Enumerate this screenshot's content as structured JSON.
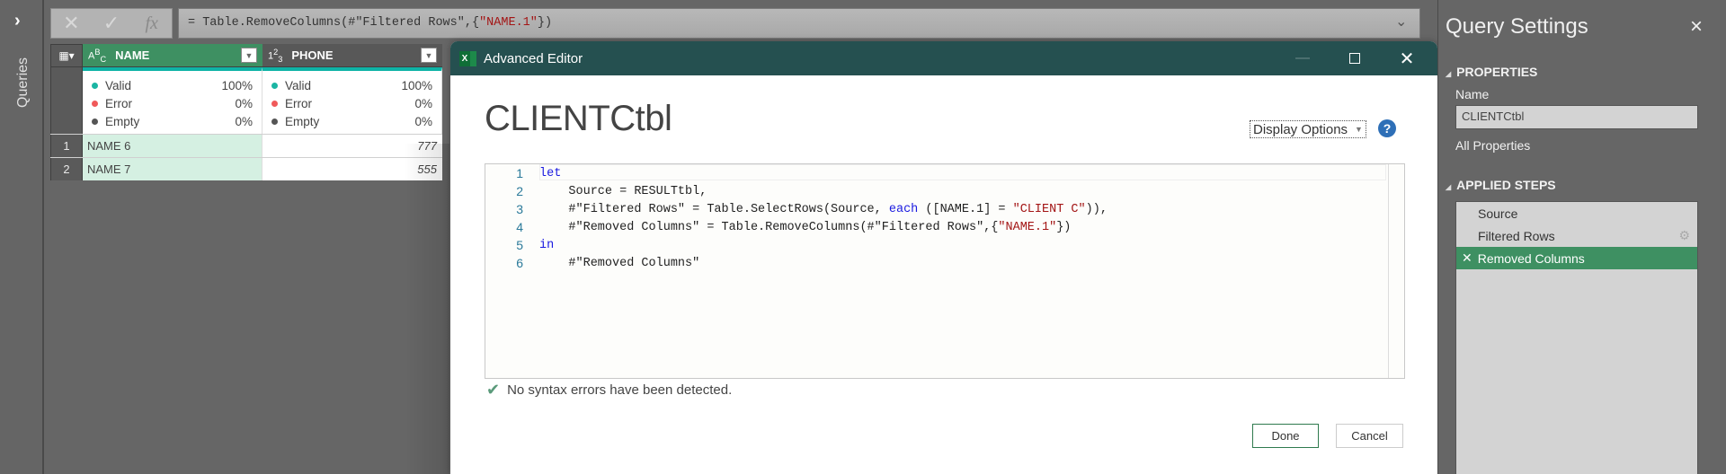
{
  "rail": {
    "label": "Queries",
    "expand_icon": "chevron-right-icon"
  },
  "formula_bar": {
    "prefix": "= Table.RemoveColumns(#\"Filtered Rows\",{",
    "string_part": "\"NAME.1\"",
    "suffix": "})",
    "cancel_glyph": "✕",
    "commit_glyph": "✓",
    "fx_label": "fx"
  },
  "grid": {
    "columns": [
      {
        "name": "NAME",
        "type_glyph": "ABC",
        "selected": true
      },
      {
        "name": "PHONE",
        "type_glyph": "123",
        "selected": false
      }
    ],
    "profile": [
      {
        "valid_label": "Valid",
        "valid": "100%",
        "error_label": "Error",
        "error": "0%",
        "empty_label": "Empty",
        "empty": "0%"
      },
      {
        "valid_label": "Valid",
        "valid": "100%",
        "error_label": "Error",
        "error": "0%",
        "empty_label": "Empty",
        "empty": "0%"
      }
    ],
    "rows": [
      {
        "num": "1",
        "name": "NAME 6",
        "phone": "777"
      },
      {
        "num": "2",
        "name": "NAME 7",
        "phone": "555"
      }
    ],
    "colors": {
      "valid": "#1bb5a3",
      "error": "#f0595a",
      "empty": "#555555",
      "header_selected": "#3e9062"
    }
  },
  "dialog": {
    "title": "Advanced Editor",
    "query_name": "CLIENTCtbl",
    "display_options_label": "Display Options",
    "help_glyph": "?",
    "code_lines": [
      {
        "n": "1",
        "parts": [
          {
            "t": "let",
            "c": "kw"
          }
        ]
      },
      {
        "n": "2",
        "parts": [
          {
            "t": "    Source = RESULTtbl,",
            "c": ""
          }
        ]
      },
      {
        "n": "3",
        "parts": [
          {
            "t": "    #\"Filtered Rows\" = Table.SelectRows(Source, ",
            "c": ""
          },
          {
            "t": "each",
            "c": "kw"
          },
          {
            "t": " ([NAME.1] = ",
            "c": ""
          },
          {
            "t": "\"CLIENT C\"",
            "c": "str"
          },
          {
            "t": ")),",
            "c": ""
          }
        ]
      },
      {
        "n": "4",
        "parts": [
          {
            "t": "    #\"Removed Columns\" = Table.RemoveColumns(#\"Filtered Rows\",{",
            "c": ""
          },
          {
            "t": "\"NAME.1\"",
            "c": "str"
          },
          {
            "t": "})",
            "c": ""
          }
        ]
      },
      {
        "n": "5",
        "parts": [
          {
            "t": "in",
            "c": "kw"
          }
        ]
      },
      {
        "n": "6",
        "parts": [
          {
            "t": "    #\"Removed Columns\"",
            "c": ""
          }
        ]
      }
    ],
    "status": "No syntax errors have been detected.",
    "done_label": "Done",
    "cancel_label": "Cancel"
  },
  "settings": {
    "title": "Query Settings",
    "properties_heading": "PROPERTIES",
    "name_label": "Name",
    "name_value": "CLIENTCtbl",
    "all_properties_link": "All Properties",
    "applied_steps_heading": "APPLIED STEPS",
    "steps": [
      {
        "label": "Source",
        "has_settings": false,
        "active": false
      },
      {
        "label": "Filtered Rows",
        "has_settings": true,
        "active": false
      },
      {
        "label": "Removed Columns",
        "has_settings": false,
        "active": true
      }
    ]
  }
}
